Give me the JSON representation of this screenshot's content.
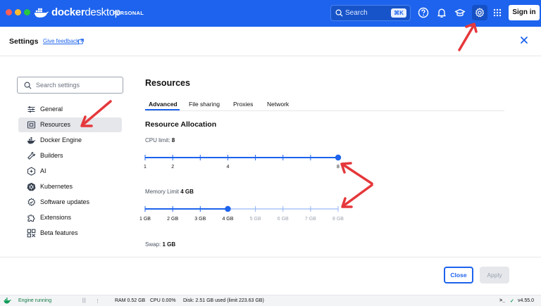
{
  "app": {
    "logo_brand": "docker",
    "logo_product": "desktop",
    "plan_badge": "PERSONAL"
  },
  "topbar": {
    "search_placeholder": "Search",
    "search_shortcut": "⌘K",
    "icons": [
      "help-icon",
      "bell-icon",
      "learn-icon",
      "gear-icon",
      "apps-grid-icon"
    ],
    "signin_label": "Sign in"
  },
  "settings": {
    "title": "Settings",
    "feedback_label": "Give feedback",
    "search_placeholder": "Search settings",
    "nav": [
      {
        "label": "General",
        "icon": "sliders-icon"
      },
      {
        "label": "Resources",
        "icon": "resources-icon",
        "active": true
      },
      {
        "label": "Docker Engine",
        "icon": "engine-icon"
      },
      {
        "label": "Builders",
        "icon": "wrench-icon"
      },
      {
        "label": "AI",
        "icon": "ai-icon"
      },
      {
        "label": "Kubernetes",
        "icon": "kubernetes-icon"
      },
      {
        "label": "Software updates",
        "icon": "update-icon"
      },
      {
        "label": "Extensions",
        "icon": "puzzle-icon"
      },
      {
        "label": "Beta features",
        "icon": "beta-icon"
      }
    ]
  },
  "main": {
    "title": "Resources",
    "tabs": [
      "Advanced",
      "File sharing",
      "Proxies",
      "Network"
    ],
    "active_tab": "Advanced",
    "section_title": "Resource Allocation",
    "cpu": {
      "label": "CPU limit:",
      "value": "8",
      "min": 1,
      "max": 8,
      "current": 8,
      "steps": 8,
      "tick_labels": [
        "1",
        "2",
        "4",
        "8"
      ],
      "tick_label_values": [
        1,
        2,
        4,
        8
      ]
    },
    "memory": {
      "label": "Memory Limit",
      "value": "4 GB",
      "min": 1,
      "max": 8,
      "current": 4,
      "steps": 8,
      "tick_labels": [
        "1 GB",
        "2 GB",
        "3 GB",
        "4 GB",
        "5 GB",
        "6 GB",
        "7 GB",
        "8 GB"
      ],
      "tick_label_values": [
        1,
        2,
        3,
        4,
        5,
        6,
        7,
        8
      ]
    },
    "swap": {
      "label": "Swap:",
      "value": "1 GB"
    }
  },
  "footer": {
    "close_label": "Close",
    "apply_label": "Apply"
  },
  "statusbar": {
    "engine_status": "Engine running",
    "ram": "RAM 0.52 GB",
    "cpu": "CPU 0.00%",
    "disk": "Disk: 2.51 GB used (limit 223.63 GB)",
    "version": "v4.55.0"
  },
  "colors": {
    "brand_blue": "#1d63ed",
    "arrow_red": "#e5383b",
    "engine_green": "#0f9d58"
  }
}
